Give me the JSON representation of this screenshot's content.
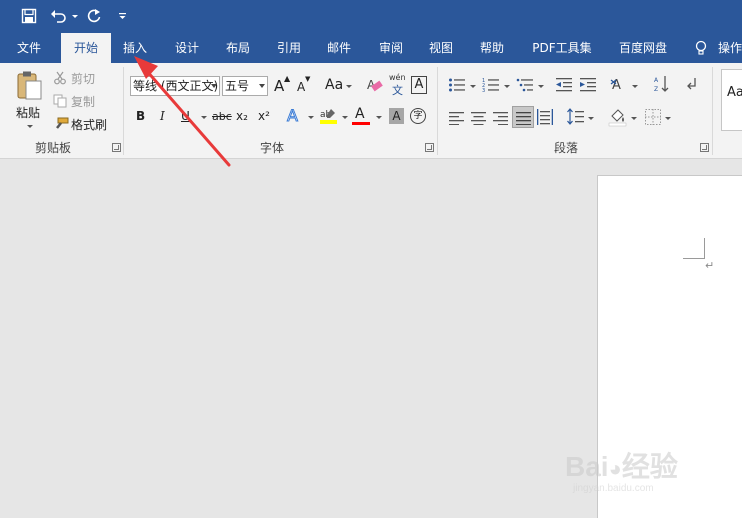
{
  "quick_access": {
    "icons": [
      "save-icon",
      "undo-icon",
      "redo-icon",
      "customize-qat-icon"
    ]
  },
  "tabs": [
    {
      "label": "文件",
      "active": false
    },
    {
      "label": "开始",
      "active": true
    },
    {
      "label": "插入",
      "active": false
    },
    {
      "label": "设计",
      "active": false
    },
    {
      "label": "布局",
      "active": false
    },
    {
      "label": "引用",
      "active": false
    },
    {
      "label": "邮件",
      "active": false
    },
    {
      "label": "审阅",
      "active": false
    },
    {
      "label": "视图",
      "active": false
    },
    {
      "label": "帮助",
      "active": false
    },
    {
      "label": "PDF工具集",
      "active": false
    },
    {
      "label": "百度网盘",
      "active": false
    }
  ],
  "tell_me": {
    "label": "操作"
  },
  "clipboard": {
    "paste": "粘贴",
    "cut": "剪切",
    "copy": "复制",
    "format_painter": "格式刷",
    "group_label": "剪贴板"
  },
  "font": {
    "font_name": "等线 (西文正文)",
    "font_size": "五号",
    "group_label": "字体",
    "phonetic_top": "wén",
    "phonetic_bottom": "文",
    "bold": "B",
    "italic": "I",
    "underline": "U",
    "strikethrough": "abc",
    "subscript": "x₂",
    "superscript": "x²",
    "text_effect": "A",
    "font_color": "A",
    "char_shading": "A",
    "enclose": "字",
    "change_case": "Aa",
    "grow": "A",
    "shrink": "A",
    "char_border": "A"
  },
  "paragraph": {
    "group_label": "段落"
  },
  "styles": {
    "preview": "Aa"
  },
  "colors": {
    "titlebar": "#2b579a",
    "ribbon": "#f3f3f3",
    "workspace": "#e6e6e6",
    "highlight": "#ffff00",
    "font_red": "#ff0000",
    "arrow": "#e83a3a"
  }
}
